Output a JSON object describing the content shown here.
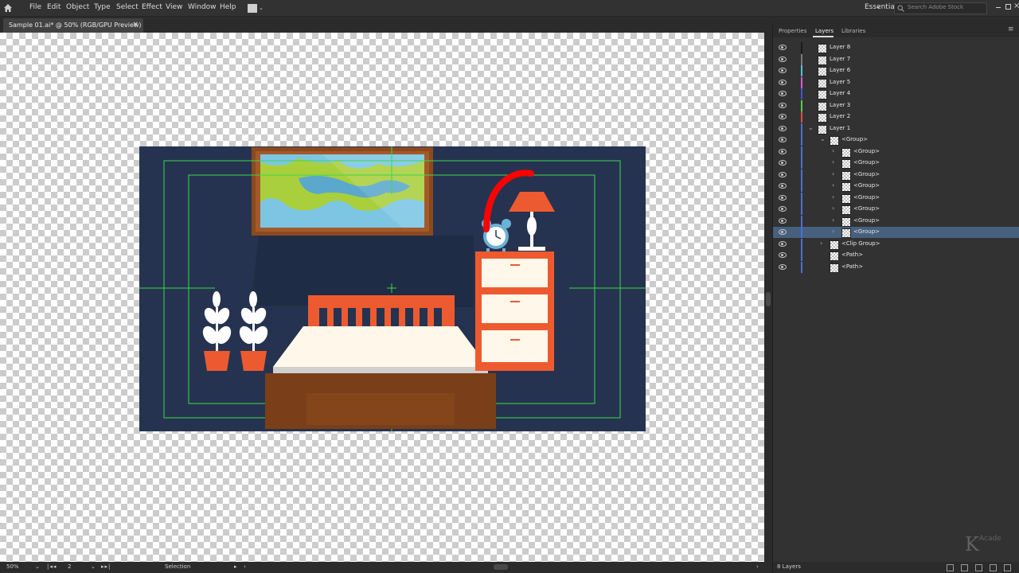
{
  "menubar": {
    "items": [
      "File",
      "Edit",
      "Object",
      "Type",
      "Select",
      "Effect",
      "View",
      "Window",
      "Help"
    ],
    "workspace": "Essentials",
    "search_placeholder": "Search Adobe Stock"
  },
  "document_tab": {
    "title": "Sample 01.ai* @ 50% (RGB/GPU Preview)",
    "close": "×"
  },
  "statusbar": {
    "zoom": "50%",
    "artboard": "2",
    "tool": "Selection"
  },
  "panel": {
    "tabs": [
      "Properties",
      "Layers",
      "Libraries"
    ],
    "active_tab": "Layers",
    "footer_count": "8 Layers",
    "layers": [
      {
        "name": "Layer 8",
        "color": "#1a1a1a",
        "indent": 0,
        "chevron": ""
      },
      {
        "name": "Layer 7",
        "color": "#7a7a7a",
        "indent": 0,
        "chevron": ""
      },
      {
        "name": "Layer 6",
        "color": "#4fc3d9",
        "indent": 0,
        "chevron": ""
      },
      {
        "name": "Layer 5",
        "color": "#d85bd8",
        "indent": 0,
        "chevron": ""
      },
      {
        "name": "Layer 4",
        "color": "#3e56d6",
        "indent": 0,
        "chevron": ""
      },
      {
        "name": "Layer 3",
        "color": "#4fd04f",
        "indent": 0,
        "chevron": ""
      },
      {
        "name": "Layer 2",
        "color": "#e04b4b",
        "indent": 0,
        "chevron": ""
      },
      {
        "name": "Layer 1",
        "color": "#4a6fd8",
        "indent": 0,
        "chevron": "⌄"
      },
      {
        "name": "<Group>",
        "color": "#4a6fd8",
        "indent": 1,
        "chevron": "⌄"
      },
      {
        "name": "<Group>",
        "color": "#4a6fd8",
        "indent": 2,
        "chevron": "›"
      },
      {
        "name": "<Group>",
        "color": "#4a6fd8",
        "indent": 2,
        "chevron": "›"
      },
      {
        "name": "<Group>",
        "color": "#4a6fd8",
        "indent": 2,
        "chevron": "›"
      },
      {
        "name": "<Group>",
        "color": "#4a6fd8",
        "indent": 2,
        "chevron": "›"
      },
      {
        "name": "<Group>",
        "color": "#4a6fd8",
        "indent": 2,
        "chevron": "›"
      },
      {
        "name": "<Group>",
        "color": "#4a6fd8",
        "indent": 2,
        "chevron": "›"
      },
      {
        "name": "<Group>",
        "color": "#4a6fd8",
        "indent": 2,
        "chevron": "›"
      },
      {
        "name": "<Group>",
        "color": "#4a6fd8",
        "indent": 2,
        "chevron": "›",
        "selected": true
      },
      {
        "name": "<Clip Group>",
        "color": "#4a6fd8",
        "indent": 1,
        "chevron": "›"
      },
      {
        "name": "<Path>",
        "color": "#4a6fd8",
        "indent": 1,
        "chevron": ""
      },
      {
        "name": "<Path>",
        "color": "#4a6fd8",
        "indent": 1,
        "chevron": ""
      }
    ]
  },
  "watermark": {
    "letter": "K",
    "text": "Acade"
  },
  "colors": {
    "artboard_bg": "#253350",
    "accent_orange": "#ee5a2f",
    "frame_brown": "#8a4a1e",
    "bed_cream": "#fff8ea",
    "bed_base": "#7a3f18",
    "guide_green": "#3ad94a",
    "sky": "#7cc6e3",
    "grass": "#a9cf3d",
    "clock_blue": "#6ab2d6",
    "stroke_red": "#ff0000",
    "selection": "#46607e"
  }
}
